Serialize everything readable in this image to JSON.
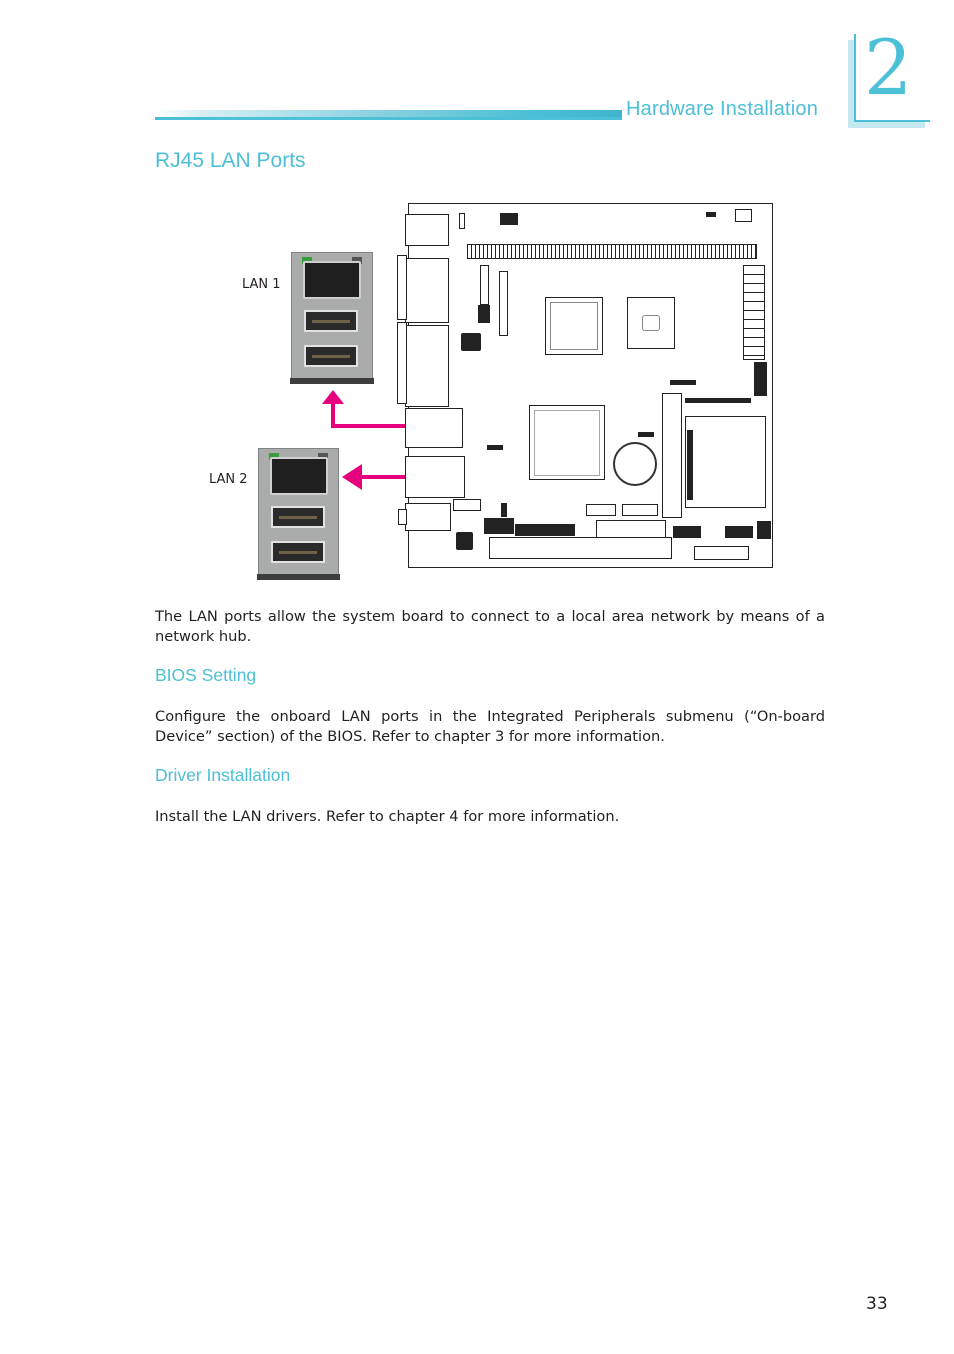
{
  "header": {
    "section_title": "Hardware Installation",
    "chapter_number": "2",
    "accent_color": "#4cc0d6"
  },
  "page": {
    "title": "RJ45 LAN Ports",
    "page_number": "33"
  },
  "figure": {
    "labels": {
      "lan1": "LAN 1",
      "lan2": "LAN 2"
    },
    "arrow_color": "#e6007e"
  },
  "sections": [
    {
      "heading": "",
      "body": "The LAN ports allow the system board to connect to a local area network by means of a network hub."
    },
    {
      "heading": "BIOS Setting",
      "body": "Configure the onboard LAN ports in the Integrated Peripherals submenu (“On-board Device” section) of the BIOS. Refer to chapter 3 for more information."
    },
    {
      "heading": "Driver Installation",
      "body": "Install the LAN drivers. Refer to chapter 4 for more information."
    }
  ]
}
